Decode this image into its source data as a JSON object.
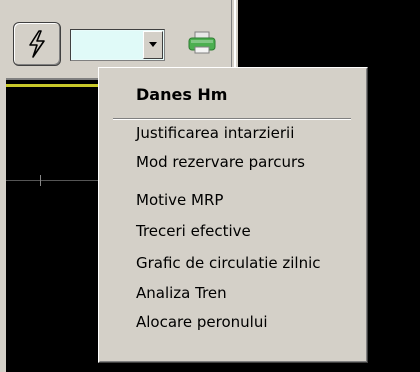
{
  "menu": {
    "title": "Danes Hm",
    "items": [
      {
        "label": "Justificarea intarzierii"
      },
      {
        "label": "Mod rezervare parcurs"
      },
      {
        "label": "Motive MRP"
      },
      {
        "label": "Treceri efective"
      },
      {
        "label": "Grafic de circulatie zilnic"
      },
      {
        "label": "Analiza Tren"
      },
      {
        "label": "Alocare peronului"
      }
    ]
  },
  "toolbar": {
    "lightning_icon": "lightning-icon",
    "combo_value": "",
    "combo_arrow_icon": "dropdown-arrow-icon",
    "printer_icon": "printer-icon"
  },
  "colors": {
    "toolbar_bg": "#d4d0c8",
    "combo_bg": "#e0faf8",
    "yellow_line": "#c9c92a",
    "printer_green": "#4caf50"
  }
}
